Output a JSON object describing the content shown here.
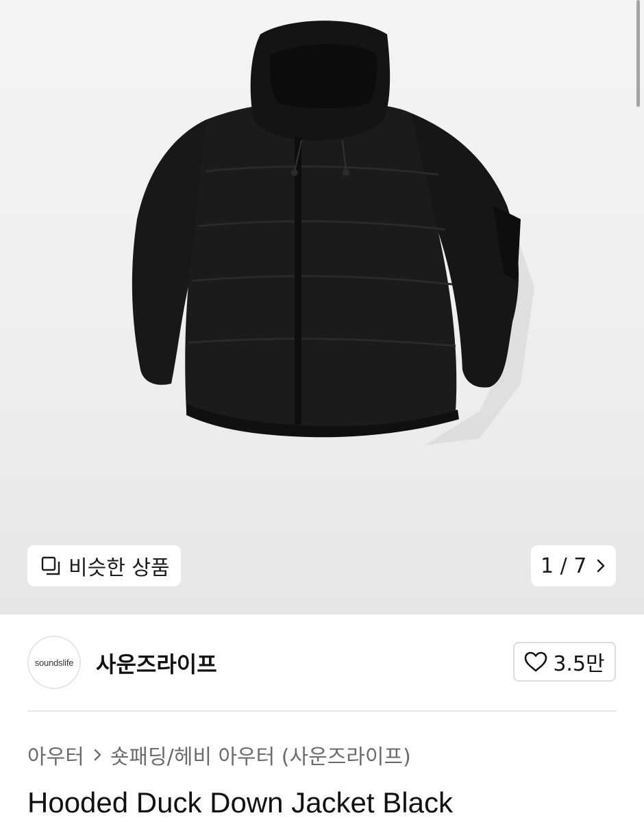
{
  "gallery": {
    "similar_label": "비슷한 상품",
    "counter": "1 / 7"
  },
  "seller": {
    "avatar_text": "soundslife",
    "name": "사운즈라이프",
    "likes": "3.5만"
  },
  "breadcrumb": {
    "category": "아우터",
    "subcategory": "숏패딩/헤비 아우터 (사운즈라이프)"
  },
  "product": {
    "title": "Hooded Duck Down Jacket Black"
  }
}
